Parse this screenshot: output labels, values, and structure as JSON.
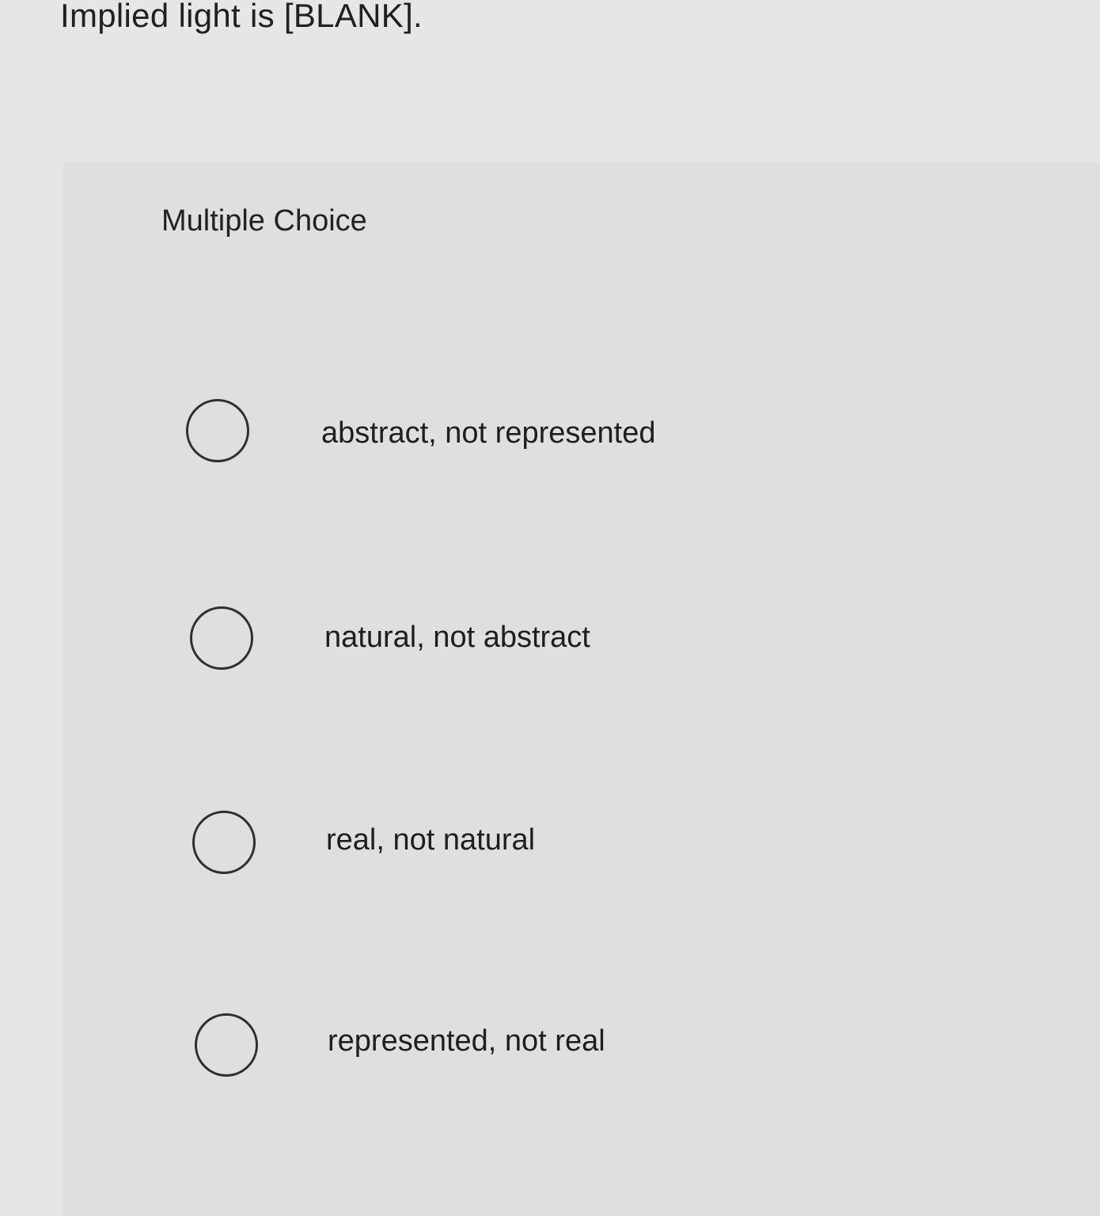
{
  "question": {
    "text": "Implied light is [BLANK]."
  },
  "card": {
    "label": "Multiple Choice"
  },
  "choices": [
    {
      "label": "abstract, not represented",
      "selected": false
    },
    {
      "label": "natural, not abstract",
      "selected": false
    },
    {
      "label": "real, not natural",
      "selected": false
    },
    {
      "label": "represented, not real",
      "selected": false
    }
  ],
  "colors": {
    "page_background": "#e6e6e4",
    "card_background": "#dfdfdd",
    "radio_border": "#2b2f36",
    "text": "#1f1f1f"
  }
}
